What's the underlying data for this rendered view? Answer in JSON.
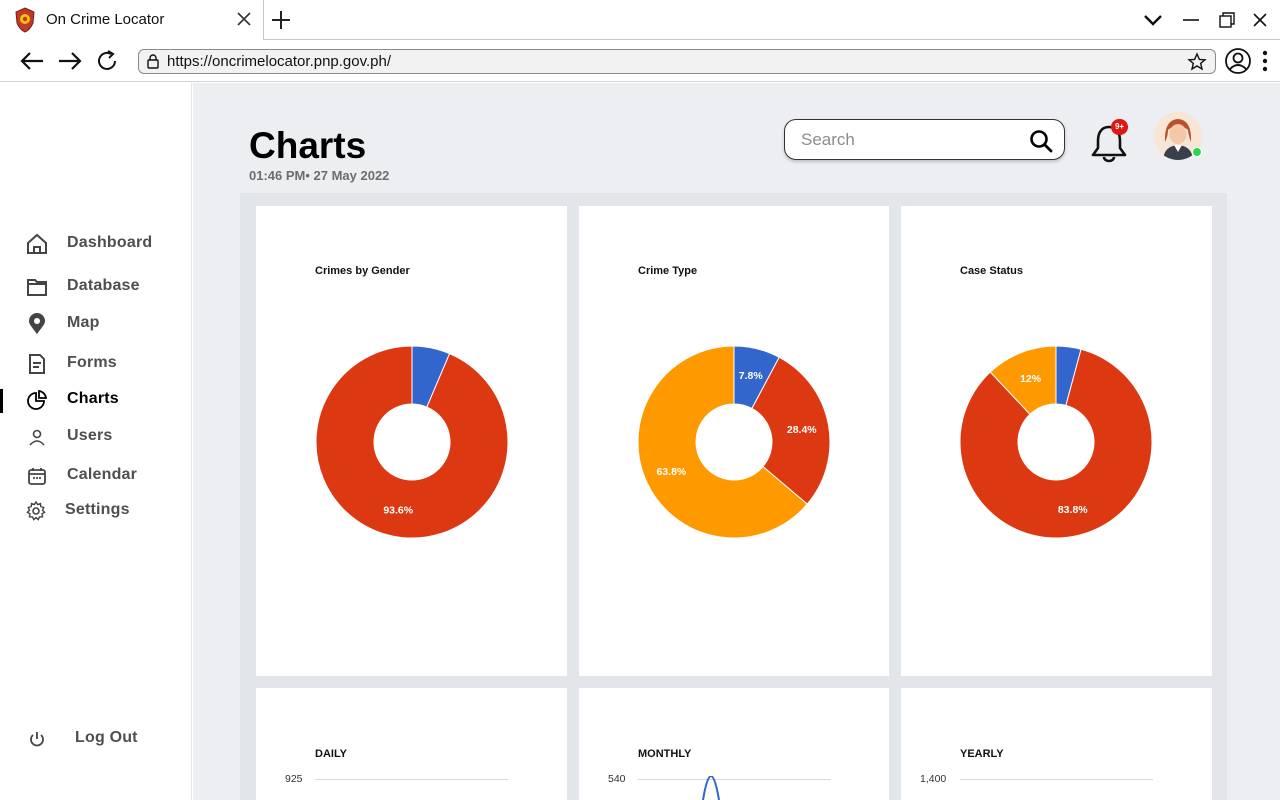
{
  "browser": {
    "tab_title": "On Crime Locator",
    "url": "https://oncrimelocator.pnp.gov.ph/"
  },
  "sidebar": {
    "items": [
      {
        "label": "Dashboard",
        "icon": "home-icon",
        "active": false
      },
      {
        "label": "Database",
        "icon": "folder-icon",
        "active": false
      },
      {
        "label": "Map",
        "icon": "map-pin-icon",
        "active": false
      },
      {
        "label": "Forms",
        "icon": "form-document-icon",
        "active": false
      },
      {
        "label": "Charts",
        "icon": "pie-chart-icon",
        "active": true
      },
      {
        "label": "Users",
        "icon": "user-icon",
        "active": false
      },
      {
        "label": "Calendar",
        "icon": "calendar-icon",
        "active": false
      },
      {
        "label": "Settings",
        "icon": "gear-icon",
        "active": false
      }
    ],
    "logout_label": "Log Out"
  },
  "header": {
    "title": "Charts",
    "datetime": "01:46 PM• 27 May 2022",
    "search_placeholder": "Search",
    "notification_badge": "9+"
  },
  "colors": {
    "blue": "#3366cc",
    "red": "#dc3912",
    "orange": "#ff9900",
    "background": "#eceef1",
    "online": "#2bd64f"
  },
  "chart_data": [
    {
      "type": "pie",
      "title": "Crimes by Gender",
      "slices": [
        {
          "value": 6.4,
          "color": "#3366cc",
          "label": ""
        },
        {
          "value": 93.6,
          "color": "#dc3912",
          "label": "93.6%"
        }
      ]
    },
    {
      "type": "pie",
      "title": "Crime Type",
      "slices": [
        {
          "value": 7.8,
          "color": "#3366cc",
          "label": "7.8%"
        },
        {
          "value": 28.4,
          "color": "#dc3912",
          "label": "28.4%"
        },
        {
          "value": 63.8,
          "color": "#ff9900",
          "label": "63.8%"
        }
      ]
    },
    {
      "type": "pie",
      "title": "Case Status",
      "slices": [
        {
          "value": 4.2,
          "color": "#3366cc",
          "label": ""
        },
        {
          "value": 83.8,
          "color": "#dc3912",
          "label": "83.8%"
        },
        {
          "value": 12,
          "color": "#ff9900",
          "label": "12%"
        }
      ]
    },
    {
      "type": "line",
      "title": "DAILY",
      "y_top_tick": "925"
    },
    {
      "type": "line",
      "title": "MONTHLY",
      "y_top_tick": "540"
    },
    {
      "type": "line",
      "title": "YEARLY",
      "y_top_tick": "1,400"
    }
  ]
}
